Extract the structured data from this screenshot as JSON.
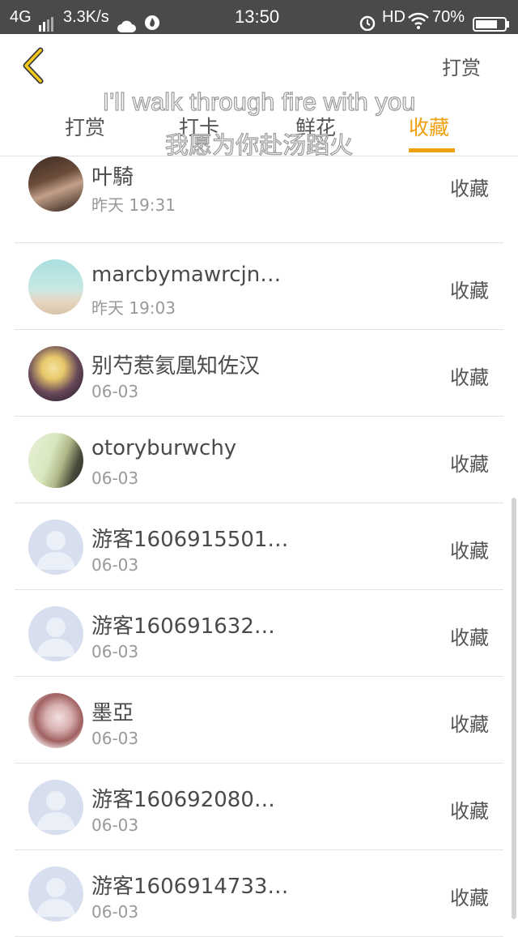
{
  "status_bar": {
    "network": "4G",
    "speed": "3.3K/s",
    "time": "13:50",
    "hd": "HD",
    "battery": "70%",
    "icons": [
      "signal-bars-icon",
      "cloud-icon",
      "flame-icon",
      "alarm-icon",
      "wifi-icon",
      "battery-icon"
    ]
  },
  "header": {
    "back_icon": "chevron-left-icon",
    "action_label": "打赏",
    "accent_color": "#f0a00f"
  },
  "tabs": [
    {
      "label": "打赏"
    },
    {
      "label": "打卡"
    },
    {
      "label": "鲜花"
    },
    {
      "label": "收藏",
      "active": true
    }
  ],
  "subtitle": {
    "en": "I'll walk through fire with you",
    "zh": "我愿为你赴汤蹈火"
  },
  "list": [
    {
      "name": "叶騎",
      "time": "昨天 19:31",
      "action": "收藏",
      "avatar": "photo"
    },
    {
      "name": "marcbymawrcjn…",
      "time": "昨天 19:03",
      "action": "收藏",
      "avatar": "photo"
    },
    {
      "name": "别芍惹氦凰知佐汉",
      "time": "06-03",
      "action": "收藏",
      "avatar": "photo"
    },
    {
      "name": "otoryburwchy",
      "time": "06-03",
      "action": "收藏",
      "avatar": "photo"
    },
    {
      "name": "游客1606915501…",
      "time": "06-03",
      "action": "收藏",
      "avatar": "default"
    },
    {
      "name": "游客160691632…",
      "time": "06-03",
      "action": "收藏",
      "avatar": "default"
    },
    {
      "name": "墨亞",
      "time": "06-03",
      "action": "收藏",
      "avatar": "photo"
    },
    {
      "name": "游客160692080…",
      "time": "06-03",
      "action": "收藏",
      "avatar": "default"
    },
    {
      "name": "游客1606914733…",
      "time": "06-03",
      "action": "收藏",
      "avatar": "default"
    }
  ]
}
